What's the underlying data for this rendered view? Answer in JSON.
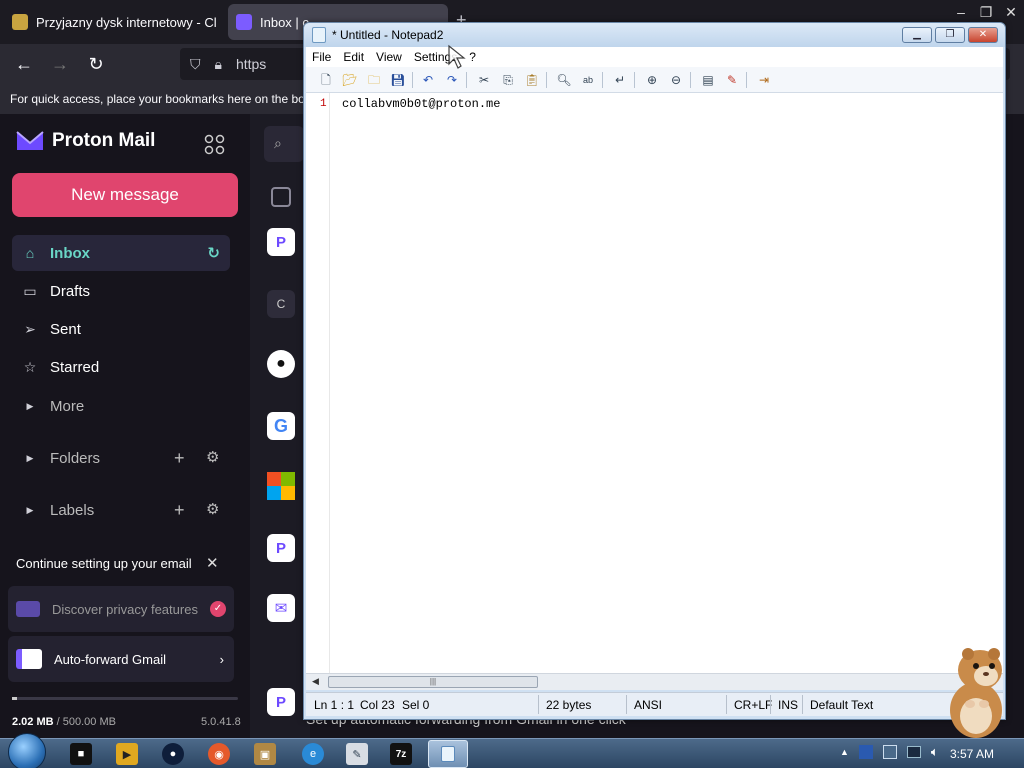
{
  "browser": {
    "tabs": [
      {
        "title": "Przyjazny dysk internetowy - Cl"
      },
      {
        "title": "Inbox | c"
      }
    ],
    "url_fragment": "https",
    "bookmarks_hint": "For quick access, place your bookmarks here on the boo"
  },
  "proton": {
    "brand": "Proton Mail",
    "new_message": "New message",
    "nav": {
      "inbox": "Inbox",
      "drafts": "Drafts",
      "sent": "Sent",
      "starred": "Starred",
      "more": "More",
      "folders": "Folders",
      "labels": "Labels"
    },
    "setup": {
      "title": "Continue setting up your email",
      "cards": [
        {
          "label": "Discover privacy features"
        },
        {
          "label": "Auto-forward Gmail"
        }
      ]
    },
    "storage": {
      "used": "2.02 MB",
      "total": "/ 500.00 MB",
      "fraction": 0.004
    },
    "version": "5.0.41.8",
    "search_placeholder": "S",
    "list_avatars": [
      "P",
      "C",
      "github",
      "G",
      "microsoft",
      "P",
      "proton-mail",
      "P"
    ],
    "bottom_snippet": "Set up automatic forwarding from Gmail in one click"
  },
  "notepad": {
    "title": "* Untitled - Notepad2",
    "menus": [
      "File",
      "Edit",
      "View",
      "Settings",
      "?"
    ],
    "line_number": "1",
    "content": "collabvm0b0t@proton.me",
    "status": {
      "position": "Ln 1 : 1",
      "col": "Col 23",
      "sel": "Sel 0",
      "size": "22 bytes",
      "encoding": "ANSI",
      "eol": "CR+LF",
      "mode": "INS",
      "scheme": "Default Text"
    }
  },
  "taskbar": {
    "clock": "3:57 AM"
  },
  "colors": {
    "proton_accent": "#e0456e",
    "inbox_active": "#6ad6c6",
    "notepad_frame": "#cfe0f2"
  }
}
